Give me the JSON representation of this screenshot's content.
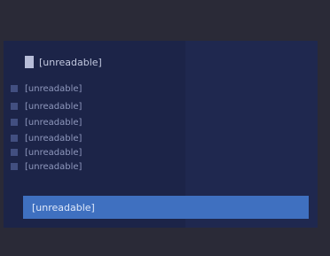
{
  "panel": {
    "title": "[unreadable]",
    "lines": [
      "[unreadable]",
      "[unreadable]",
      "[unreadable]",
      "[unreadable]",
      "[unreadable]",
      "[unreadable]"
    ],
    "primary_row": "[unreadable]"
  },
  "colors": {
    "chrome_background": "#2a2a37",
    "panel_background": "#1c2448",
    "highlight_bar": "#3f70c0"
  },
  "icons": {
    "title_icon": "app-icon"
  }
}
